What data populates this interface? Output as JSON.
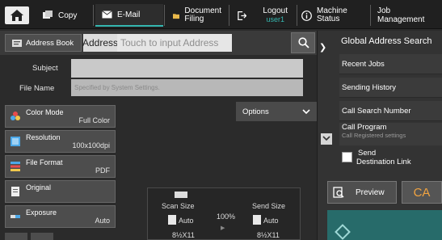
{
  "topbar": {
    "tabs": [
      {
        "label": "Copy",
        "icon": "copy-icon"
      },
      {
        "label": "E-Mail",
        "icon": "email-icon"
      },
      {
        "label": "Document Filing",
        "icon": "folder-icon"
      },
      {
        "label": "Logout",
        "sub": "user1",
        "icon": "logout-icon"
      },
      {
        "label": "Machine Status",
        "icon": "info-icon"
      },
      {
        "label": "Job Management"
      }
    ],
    "copy_label": "Copy",
    "email_label": "E-Mail",
    "docfiling_line1": "Document",
    "docfiling_line2": "Filing",
    "logout_label": "Logout",
    "logout_user": "user1",
    "machine_line1": "Machine",
    "machine_line2": "Status",
    "job_label": "Job Management"
  },
  "address": {
    "book_label": "Address Book",
    "label": "Address",
    "placeholder": "Touch to input Address"
  },
  "fields": {
    "subject_label": "Subject",
    "subject_value": "",
    "filename_label": "File Name",
    "filename_placeholder": "Specified by System Settings."
  },
  "options_label": "Options",
  "settings": [
    {
      "label": "Color Mode",
      "value": "Full Color"
    },
    {
      "label": "Resolution",
      "value": "100x100dpi"
    },
    {
      "label": "File Format",
      "value": "PDF"
    },
    {
      "label": "Original",
      "value": ""
    },
    {
      "label": "Exposure",
      "value": "Auto"
    }
  ],
  "size_panel": {
    "scan_label": "Scan Size",
    "scan_value": "Auto",
    "scan_paper": "8½X11",
    "ratio": "100%",
    "send_label": "Send Size",
    "send_value": "Auto",
    "send_paper": "8½X11"
  },
  "right_panel": {
    "title": "Global Address Search",
    "items": [
      "Recent Jobs",
      "Sending History",
      "Call Search Number"
    ],
    "call_program": "Call Program",
    "call_program_sub": "Call Registered settings",
    "send_dest_line1": "Send",
    "send_dest_line2": "Destination Link"
  },
  "preview_label": "Preview",
  "ca_label": "CA",
  "colors": {
    "accent": "#35b7b0",
    "ca": "#f1a340",
    "start": "#276b6a"
  }
}
